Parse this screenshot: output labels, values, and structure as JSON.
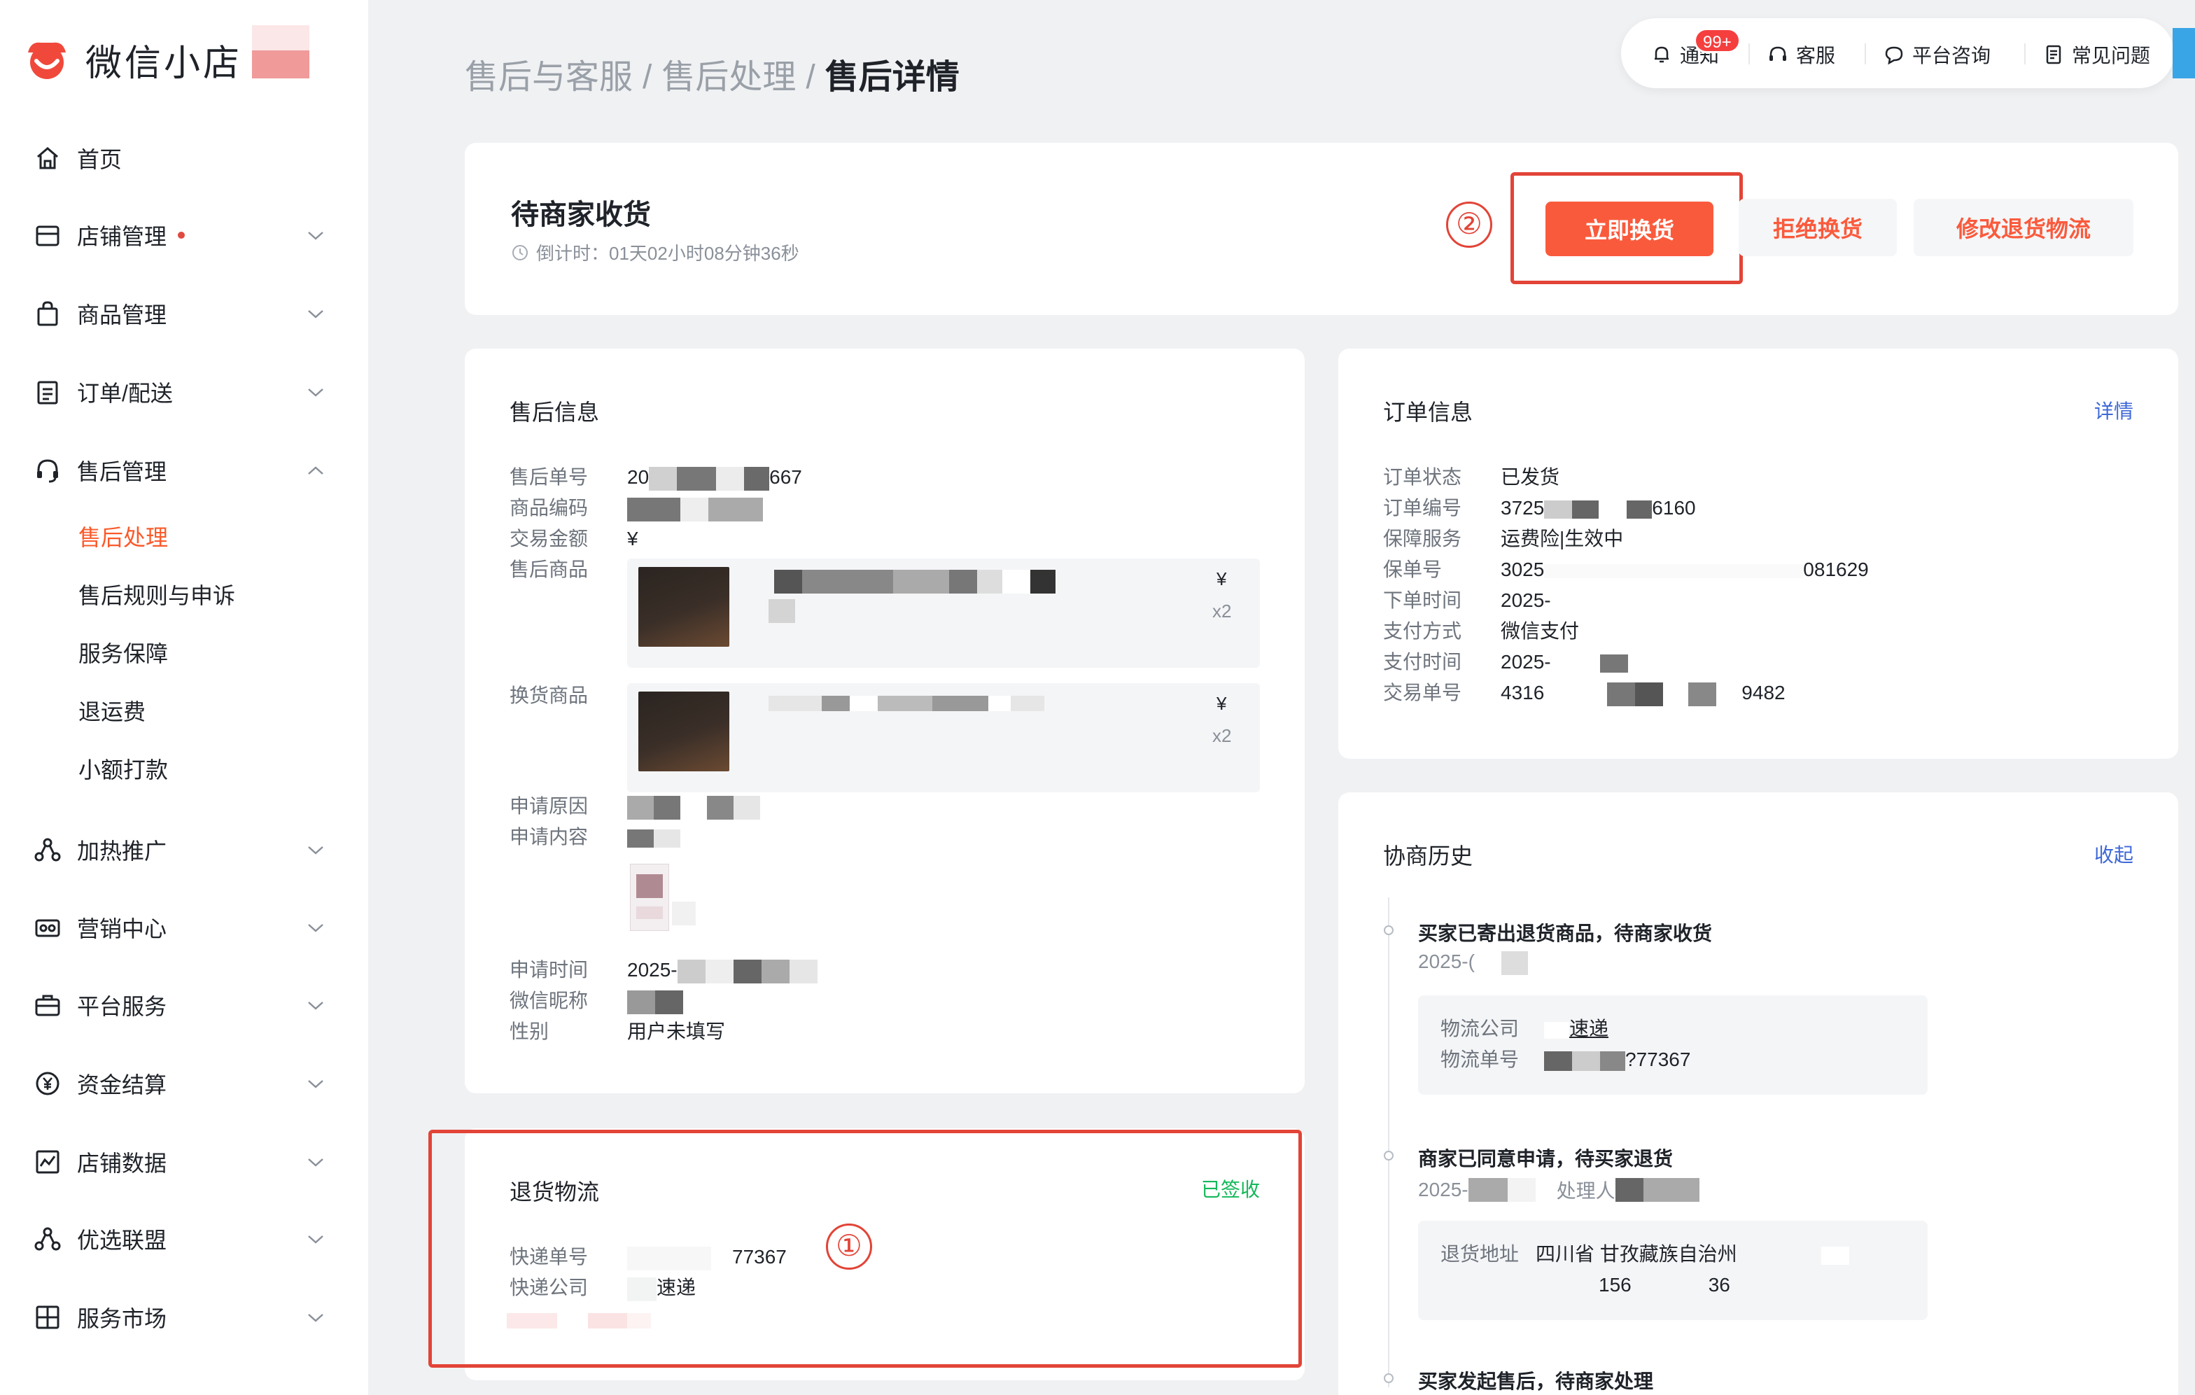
{
  "app": {
    "logo_text": "微信小店"
  },
  "breadcrumb": {
    "items": [
      "售后与客服",
      "售后处理"
    ],
    "current": "售后详情",
    "separator": "/"
  },
  "topbar": {
    "notify": "通知",
    "notify_badge": "99+",
    "service": "客服",
    "consult": "平台咨询",
    "faq": "常见问题"
  },
  "sidebar": {
    "items": [
      {
        "label": "首页",
        "icon": "home-icon"
      },
      {
        "label": "店铺管理",
        "icon": "store-icon",
        "dot": true
      },
      {
        "label": "商品管理",
        "icon": "bag-icon"
      },
      {
        "label": "订单/配送",
        "icon": "order-icon"
      },
      {
        "label": "售后管理",
        "icon": "headset-icon",
        "expanded": true
      },
      {
        "label": "加热推广",
        "icon": "share-icon"
      },
      {
        "label": "营销中心",
        "icon": "coupon-icon"
      },
      {
        "label": "平台服务",
        "icon": "briefcase-icon"
      },
      {
        "label": "资金结算",
        "icon": "yuan-icon"
      },
      {
        "label": "店铺数据",
        "icon": "chart-icon"
      },
      {
        "label": "优选联盟",
        "icon": "network-icon"
      },
      {
        "label": "服务市场",
        "icon": "market-icon"
      }
    ],
    "sub_items": [
      "售后处理",
      "售后规则与申诉",
      "服务保障",
      "退运费",
      "小额打款"
    ]
  },
  "status": {
    "title": "待商家收货",
    "countdown_label": "倒计时：",
    "countdown": "01天02小时08分钟36秒",
    "btn_exchange": "立即换货",
    "btn_reject": "拒绝换货",
    "btn_modify": "修改退货物流",
    "marker": "②"
  },
  "aftersale": {
    "title": "售后信息",
    "labels": {
      "id": "售后单号",
      "sku": "商品编码",
      "amount": "交易金额",
      "product": "售后商品",
      "exchange": "换货商品",
      "reason": "申请原因",
      "content": "申请内容",
      "time": "申请时间",
      "nickname": "微信昵称",
      "gender": "性别"
    },
    "id_prefix": "20",
    "id_suffix": "667",
    "amount_symbol": "¥",
    "product_price": "¥",
    "product_qty": "x2",
    "exchange_price": "¥",
    "exchange_qty": "x2",
    "time_prefix": "2025-",
    "gender": "用户未填写"
  },
  "order": {
    "title": "订单信息",
    "detail_link": "详情",
    "labels": {
      "status": "订单状态",
      "id": "订单编号",
      "service": "保障服务",
      "policy": "保单号",
      "order_time": "下单时间",
      "pay_method": "支付方式",
      "pay_time": "支付时间",
      "trade_id": "交易单号"
    },
    "status": "已发货",
    "id_prefix": "3725",
    "id_suffix": "6160",
    "service": "运费险|生效中",
    "policy_prefix": "3025",
    "policy_suffix": "081629",
    "order_time": "2025-",
    "pay_method": "微信支付",
    "pay_time": "2025-",
    "trade_prefix": "4316",
    "trade_suffix": "9482"
  },
  "return_logistics": {
    "title": "退货物流",
    "status": "已签收",
    "labels": {
      "tracking": "快递单号",
      "company": "快递公司"
    },
    "tracking_suffix": "77367",
    "company_suffix": "速递",
    "marker": "①"
  },
  "history": {
    "title": "协商历史",
    "collapse": "收起",
    "events": [
      {
        "title": "买家已寄出退货商品，待商家收货",
        "time": "2025-(",
        "box": {
          "l1": "物流公司",
          "v1": "速递",
          "l2": "物流单号",
          "v2": "?77367"
        }
      },
      {
        "title": "商家已同意申请，待买家退货",
        "time": "2025-",
        "handler": "处理人",
        "box": {
          "l1": "退货地址",
          "v1": "四川省 甘孜藏族自治州",
          "v2a": "156",
          "v2b": "36"
        }
      },
      {
        "title": "买家发起售后，待商家处理"
      }
    ]
  },
  "colors": {
    "accent": "#fa5a3c",
    "active_nav": "#fa5a2a",
    "link": "#3e68d6",
    "success": "#14b85a",
    "annotation": "#e24437"
  }
}
